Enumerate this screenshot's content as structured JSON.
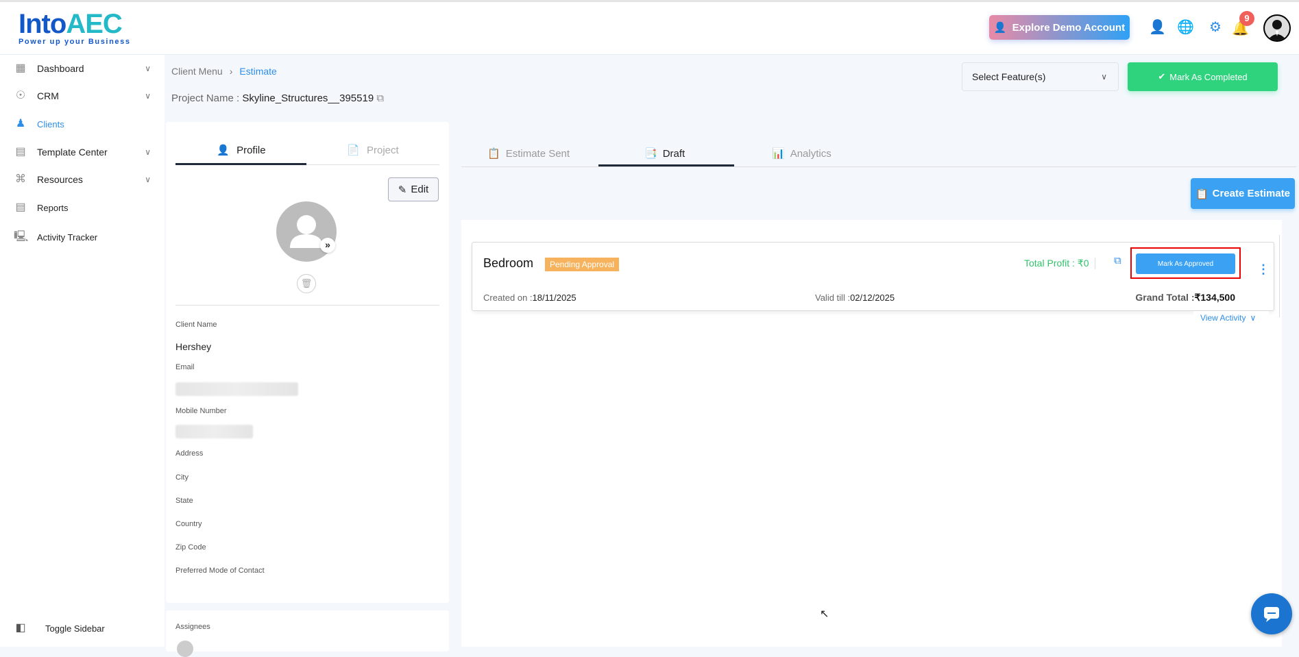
{
  "header": {
    "logo_main": "Into",
    "logo_accent": "AEC",
    "logo_tagline": "Power up your Business",
    "demo_button": "Explore Demo Account",
    "notification_count": "9"
  },
  "sidebar": {
    "items": [
      {
        "label": "Dashboard"
      },
      {
        "label": "CRM"
      },
      {
        "label": "Clients"
      },
      {
        "label": "Template Center"
      },
      {
        "label": "Resources"
      },
      {
        "label": "Reports"
      },
      {
        "label": "Activity Tracker"
      }
    ],
    "toggle": "Toggle Sidebar"
  },
  "breadcrumb": {
    "parent": "Client Menu",
    "current": "Estimate"
  },
  "project": {
    "label": "Project Name :",
    "name": "Skyline_Structures__395519"
  },
  "toolbar": {
    "select_placeholder": "Select Feature(s)",
    "complete_button": "Mark As Completed"
  },
  "profile": {
    "tabs": [
      "Profile",
      "Project"
    ],
    "edit": "Edit",
    "fields": {
      "client_name_label": "Client Name",
      "client_name": "Hershey",
      "email_label": "Email",
      "mobile_label": "Mobile Number",
      "address_label": "Address",
      "city_label": "City",
      "state_label": "State",
      "country_label": "Country",
      "zip_label": "Zip Code",
      "contact_label": "Preferred Mode of Contact"
    },
    "assignees_label": "Assignees"
  },
  "estimate": {
    "tabs": [
      "Estimate Sent",
      "Draft",
      "Analytics"
    ],
    "create_button": "Create Estimate",
    "card": {
      "title": "Bedroom",
      "status": "Pending Approval",
      "total_profit": "Total Profit : ₹0",
      "approve_button": "Mark As Approved",
      "created_label": "Created on :",
      "created": "18/11/2025",
      "valid_label": "Valid till :",
      "valid": "02/12/2025",
      "grand_total_label": "Grand Total :",
      "grand_total": "₹134,500",
      "view_activity": "View Activity"
    }
  },
  "colors": {
    "accent": "#2d8ee8",
    "success": "#2fd37d",
    "pending": "#f6b25c",
    "highlight": "#e00000"
  }
}
